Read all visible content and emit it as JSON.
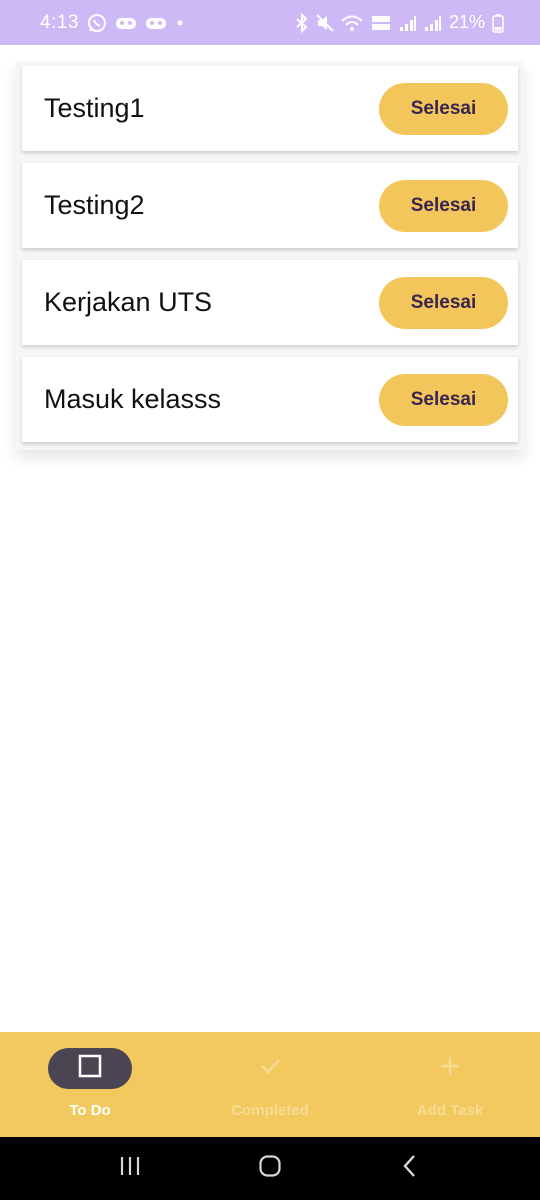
{
  "status_bar": {
    "time": "4:13",
    "battery": "21%",
    "background": "#cdb9f6"
  },
  "tasks": [
    {
      "title": "Testing1",
      "button_label": "Selesai"
    },
    {
      "title": "Testing2",
      "button_label": "Selesai"
    },
    {
      "title": "Kerjakan UTS",
      "button_label": "Selesai"
    },
    {
      "title": "Masuk kelasss",
      "button_label": "Selesai"
    }
  ],
  "bottom_nav": {
    "items": [
      {
        "label": "To Do",
        "icon": "square-outline-icon",
        "active": true
      },
      {
        "label": "Completed",
        "icon": "check-icon",
        "active": false
      },
      {
        "label": "Add Task",
        "icon": "plus-icon",
        "active": false
      }
    ],
    "background": "#f2c95f",
    "active_pill": "#4a4453"
  },
  "colors": {
    "button": "#f2c65a",
    "button_text": "#3a2450"
  }
}
